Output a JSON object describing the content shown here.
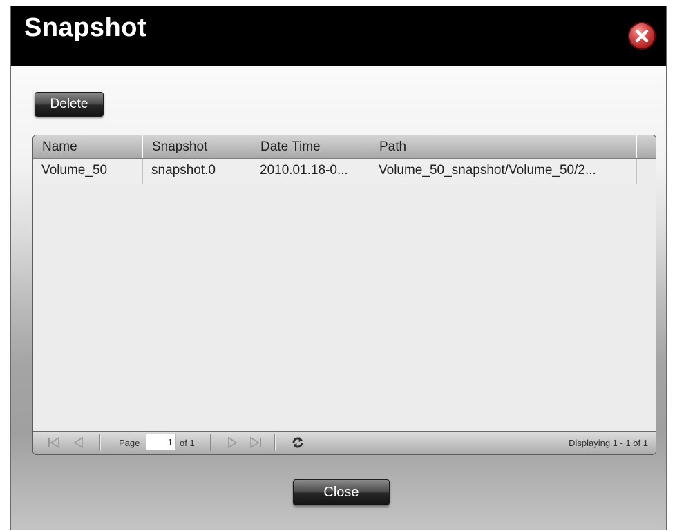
{
  "window": {
    "title": "Snapshot",
    "close_icon": "close-x-icon"
  },
  "toolbar": {
    "delete_label": "Delete"
  },
  "grid": {
    "columns": [
      "Name",
      "Snapshot",
      "Date Time",
      "Path"
    ],
    "rows": [
      {
        "name": "Volume_50",
        "snapshot": "snapshot.0",
        "date_time": "2010.01.18-0...",
        "path": "Volume_50_snapshot/Volume_50/2..."
      }
    ]
  },
  "pager": {
    "page_label": "Page",
    "page_value": "1",
    "of_label": "of 1",
    "displaying": "Displaying 1 - 1 of 1",
    "icons": [
      "first-page-icon",
      "prev-page-icon",
      "next-page-icon",
      "last-page-icon",
      "refresh-icon"
    ]
  },
  "footer": {
    "close_label": "Close"
  },
  "colors": {
    "titlebar": "#000000",
    "close_icon": "#c62f2f",
    "button": "#2a2a2a"
  }
}
